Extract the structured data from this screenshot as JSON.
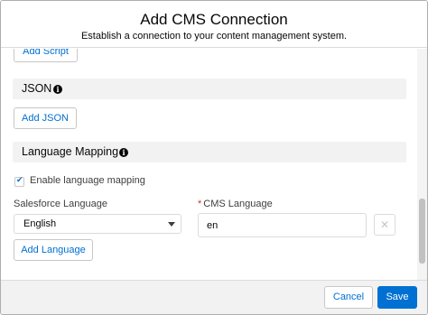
{
  "modal": {
    "title": "Add CMS Connection",
    "subtitle": "Establish a connection to your content management system."
  },
  "body": {
    "add_script_label": "Add Script",
    "json_section": {
      "title": "JSON",
      "info_icon": "info-icon",
      "add_label": "Add JSON"
    },
    "language_section": {
      "title": "Language Mapping",
      "info_icon": "info-icon",
      "enable_checkbox": {
        "label": "Enable language mapping",
        "checked": true
      },
      "salesforce_language": {
        "label": "Salesforce Language",
        "value": "English"
      },
      "cms_language": {
        "required_marker": "*",
        "label": "CMS Language",
        "value": "en"
      },
      "remove_icon": "close-icon",
      "add_language_label": "Add Language"
    }
  },
  "footer": {
    "cancel_label": "Cancel",
    "save_label": "Save"
  },
  "colors": {
    "brand": "#0070d2",
    "section_bg": "#f3f2f2",
    "required": "#c23934"
  }
}
